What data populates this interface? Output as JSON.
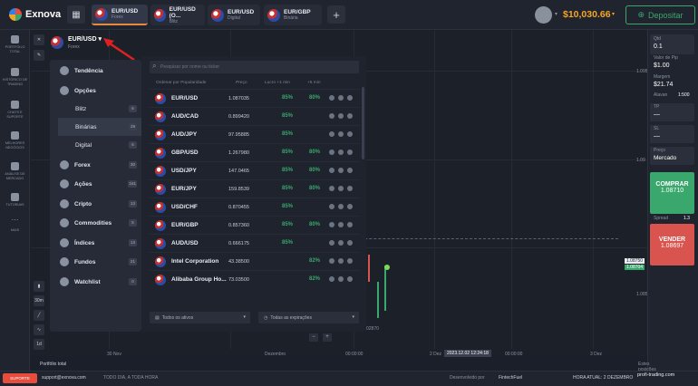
{
  "app": {
    "name": "Exnova"
  },
  "tabs": [
    {
      "label": "EUR/USD",
      "sub": "Forex",
      "active": true
    },
    {
      "label": "EUR/USD (O...",
      "sub": "Blitz",
      "active": false
    },
    {
      "label": "EUR/USD",
      "sub": "Digital",
      "active": false
    },
    {
      "label": "EUR/GBP",
      "sub": "Binária",
      "active": false
    }
  ],
  "header": {
    "balance": "$10,030.66",
    "deposit_label": "Depositar"
  },
  "sidebar": {
    "items": [
      {
        "label": "PORTFÓLIO TOTAL"
      },
      {
        "label": "HISTÓRICO DE TRADING"
      },
      {
        "label": "CHATS E SUPORTE"
      },
      {
        "label": "MELHORES NEGÓCIOS"
      },
      {
        "label": "ANÁLISE DE MERCADO"
      },
      {
        "label": "TUTORIAIS"
      },
      {
        "label": "MAIS"
      }
    ]
  },
  "asset": {
    "name": "EUR/USD",
    "category": "Forex"
  },
  "categories": [
    {
      "label": "Tendência",
      "count": ""
    },
    {
      "label": "Opções",
      "count": ""
    },
    {
      "label": "Blitz",
      "count": "6",
      "sub": true
    },
    {
      "label": "Binárias",
      "count": "29",
      "sub": true,
      "selected": true
    },
    {
      "label": "Digital",
      "count": "6",
      "sub": true
    },
    {
      "label": "Forex",
      "count": "30"
    },
    {
      "label": "Ações",
      "count": "161"
    },
    {
      "label": "Cripto",
      "count": "13"
    },
    {
      "label": "Commodities",
      "count": "5"
    },
    {
      "label": "Índices",
      "count": "13"
    },
    {
      "label": "Fundos",
      "count": "21"
    },
    {
      "label": "Watchlist",
      "count": "0"
    }
  ],
  "search": {
    "placeholder": "Pesquisar por nome ou ticker"
  },
  "columns": {
    "sort": "Ordenar por Popularidade",
    "price": "Preço",
    "profit1": "Lucro +1 min",
    "profit5": "+5 min"
  },
  "assets": [
    {
      "name": "EUR/USD",
      "price": "1.087035",
      "p1": "85%",
      "p5": "80%"
    },
    {
      "name": "AUD/CAD",
      "price": "0.899420",
      "p1": "85%",
      "p5": ""
    },
    {
      "name": "AUD/JPY",
      "price": "97.95885",
      "p1": "85%",
      "p5": ""
    },
    {
      "name": "GBP/USD",
      "price": "1.267980",
      "p1": "85%",
      "p5": "80%"
    },
    {
      "name": "USD/JPY",
      "price": "147.0465",
      "p1": "85%",
      "p5": "80%"
    },
    {
      "name": "EUR/JPY",
      "price": "159.8539",
      "p1": "85%",
      "p5": "80%"
    },
    {
      "name": "USD/CHF",
      "price": "0.870455",
      "p1": "85%",
      "p5": ""
    },
    {
      "name": "EUR/GBP",
      "price": "0.857360",
      "p1": "85%",
      "p5": "80%"
    },
    {
      "name": "AUD/USD",
      "price": "0.666175",
      "p1": "85%",
      "p5": ""
    },
    {
      "name": "Intel Corporation",
      "price": "43.38500",
      "p1": "",
      "p5": "82%"
    },
    {
      "name": "Alibaba Group Ho...",
      "price": "73.03500",
      "p1": "",
      "p5": "82%"
    }
  ],
  "filters": {
    "assets": "Todos os ativos",
    "expirations": "Todas as expirações"
  },
  "chart": {
    "y_ticks": [
      "1.095",
      "1.09",
      "1.085"
    ],
    "x_ticks": [
      "30 Nov",
      "Dezembro",
      "00:00:00",
      "2 Dez",
      "00:00:00",
      "3 Dez"
    ],
    "price_tag": "1.08750",
    "price_tag2": "1.08704",
    "time_label": "2023.12.02 12:24:18",
    "timeframe": "30m",
    "timeframe2": "1d",
    "mini_label": "02870"
  },
  "rpanel": {
    "qty_label": "Qtd",
    "qty_value": "0.1",
    "pip_label": "Valor de Pip",
    "pip_value": "$1.00",
    "margin_label": "Margem",
    "margin_value": "$21.74",
    "leverage_label": "Alavan",
    "leverage_value": "1:500",
    "tp_label": "TP",
    "tp_value": "—",
    "sl_label": "SL",
    "sl_value": "—",
    "price_label": "Preço",
    "price_mode": "Mercado",
    "buy_label": "COMPRAR",
    "buy_price": "1.08710",
    "spread_label": "Spread",
    "spread_value": "1.3",
    "sell_label": "VENDER",
    "sell_price": "1.08697"
  },
  "footer": {
    "support": "SUPORTE",
    "email": "support@exnova.com",
    "hours": "TODO DIA, A TODA HORA",
    "dev": "Desenvolvido por",
    "dev_name": "FintechFuel",
    "time": "HORA ATUAL: 2 DEZEMBRO",
    "watermark": "profi-trading.com",
    "portfolio": "Portfólio total",
    "positions": "Estes posições"
  },
  "colors": {
    "accent": "#f5a623",
    "buy": "#3aa76d",
    "sell": "#d9534f"
  }
}
